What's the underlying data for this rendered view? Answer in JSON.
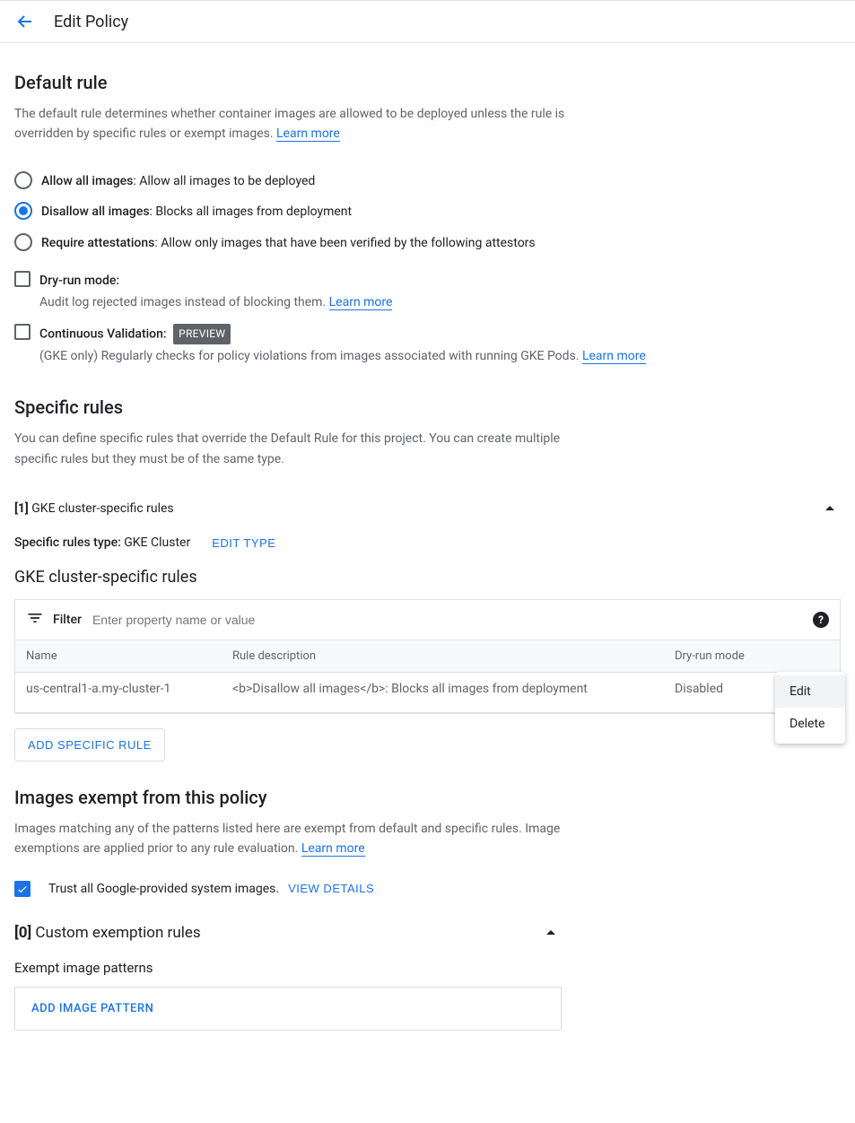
{
  "topbar": {
    "title": "Edit Policy"
  },
  "default_rule": {
    "heading": "Default rule",
    "desc": "The default rule determines whether container images are allowed to be deployed unless the rule is overridden by specific rules or exempt images. ",
    "learn_more": "Learn more",
    "options": {
      "allow": {
        "label": "Allow all images",
        "desc": ": Allow all images to be deployed"
      },
      "disallow": {
        "label": "Disallow all images",
        "desc": ": Blocks all images from deployment"
      },
      "attest": {
        "label": "Require attestations",
        "desc": ": Allow only images that have been verified by the following attestors"
      }
    },
    "dryrun": {
      "label": "Dry-run mode:",
      "desc": "Audit log rejected images instead of blocking them. ",
      "learn_more": "Learn more"
    },
    "cv": {
      "label": "Continuous Validation:",
      "badge": "PREVIEW",
      "desc": "(GKE only) Regularly checks for policy violations from images associated with running GKE Pods. ",
      "learn_more": "Learn more"
    }
  },
  "specific": {
    "heading": "Specific rules",
    "desc": "You can define specific rules that override the Default Rule for this project. You can create multiple specific rules but they must be of the same type.",
    "expand_count": "[1]",
    "expand_label": " GKE cluster-specific rules",
    "type_label": "Specific rules type: ",
    "type_value": "GKE Cluster",
    "edit_type": "EDIT TYPE",
    "subheader": "GKE cluster-specific rules",
    "filter_label": "Filter",
    "filter_placeholder": "Enter property name or value",
    "columns": {
      "name": "Name",
      "desc": "Rule description",
      "dry": "Dry-run mode"
    },
    "row": {
      "name": "us-central1-a.my-cluster-1",
      "desc": "<b>Disallow all images</b>: Blocks all images from deployment",
      "dry": "Disabled"
    },
    "menu": {
      "edit": "Edit",
      "delete": "Delete"
    },
    "add_btn": "ADD SPECIFIC RULE"
  },
  "exempt": {
    "heading": "Images exempt from this policy",
    "desc": "Images matching any of the patterns listed here are exempt from default and specific rules. Image exemptions are applied prior to any rule evaluation. ",
    "learn_more": "Learn more",
    "trust_label": "Trust all Google-provided system images.",
    "view_details": "VIEW DETAILS",
    "custom_count": "[0]",
    "custom_label": " Custom exemption rules",
    "patterns_label": "Exempt image patterns",
    "add_pattern": "ADD IMAGE PATTERN"
  }
}
